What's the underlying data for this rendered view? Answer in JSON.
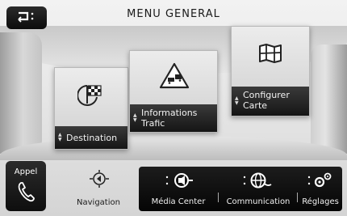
{
  "header": {
    "title": "MENU GENERAL",
    "back_icon": "back-arrow-icon"
  },
  "tiles": [
    {
      "label_line1": "Destination",
      "label_line2": "",
      "icon": "flag-icon"
    },
    {
      "label_line1": "Informations",
      "label_line2": "Trafic",
      "icon": "traffic-warning-icon"
    },
    {
      "label_line1": "Configurer",
      "label_line2": "Carte",
      "icon": "map-icon"
    }
  ],
  "bottom": {
    "appel": {
      "label": "Appel",
      "icon": "phone-icon"
    },
    "navigation": {
      "label": "Navigation",
      "icon": "navigation-icon"
    },
    "media": {
      "label": "Média Center",
      "icon": "media-icon"
    },
    "communication": {
      "label": "Communication",
      "icon": "communication-icon"
    },
    "reglages": {
      "label": "Réglages",
      "icon": "settings-icon"
    }
  },
  "colors": {
    "label_bg": "#1f1f1f",
    "panel_bg": "#e2e2e2"
  }
}
